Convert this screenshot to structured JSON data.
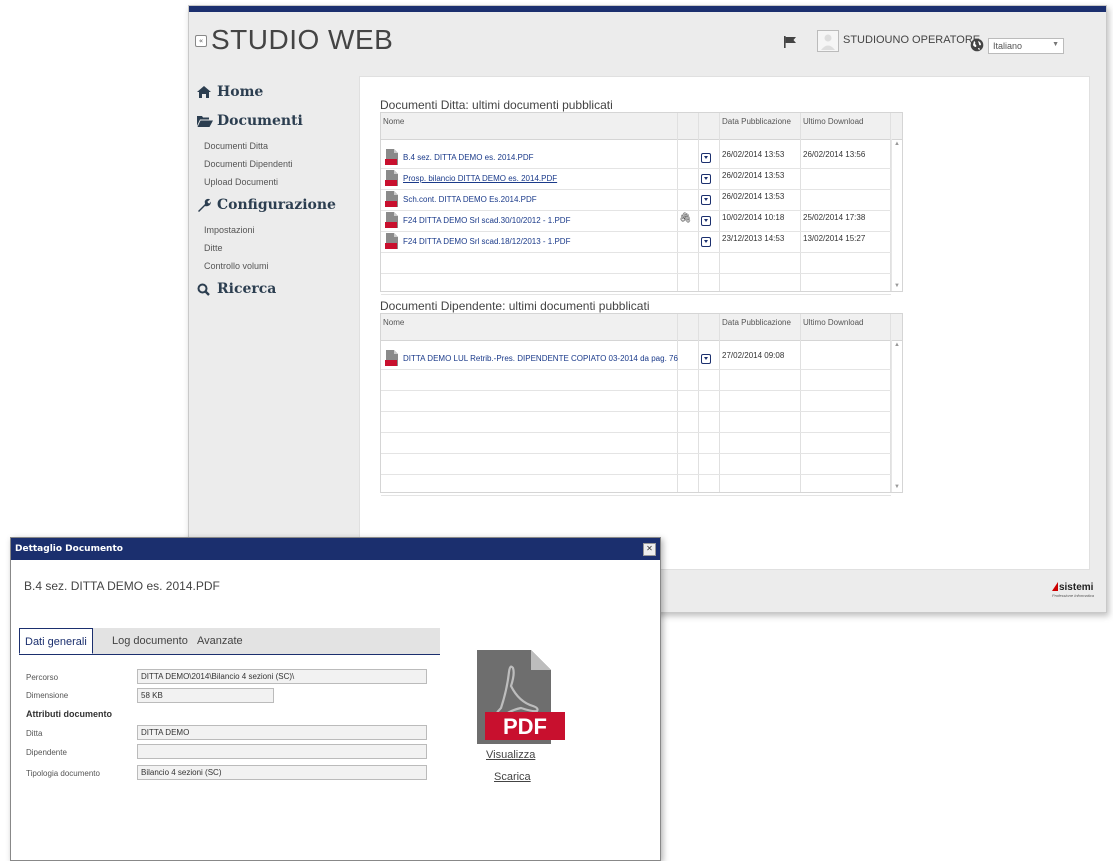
{
  "app": {
    "title": "STUDIO WEB",
    "collapse_label": "«",
    "user_name": "STUDIOUNO OPERATORE",
    "language": "Italiano"
  },
  "sidebar": {
    "home": "Home",
    "documenti": "Documenti",
    "documenti_items": [
      "Documenti Ditta",
      "Documenti Dipendenti",
      "Upload Documenti"
    ],
    "configurazione": "Configurazione",
    "configurazione_items": [
      "Impostazioni",
      "Ditte",
      "Controllo volumi"
    ],
    "ricerca": "Ricerca"
  },
  "ditta": {
    "title": "Documenti Ditta: ultimi documenti pubblicati",
    "columns": [
      "Nome",
      "Data Pubblicazione",
      "Ultimo Download"
    ],
    "rows": [
      {
        "name": "B.4 sez. DITTA DEMO es. 2014.PDF",
        "published": "26/02/2014 13:53",
        "downloaded": "26/02/2014 13:56",
        "underline": false,
        "clip": false
      },
      {
        "name": "Prosp. bilancio DITTA DEMO es. 2014.PDF",
        "published": "26/02/2014 13:53",
        "downloaded": "",
        "underline": true,
        "clip": false
      },
      {
        "name": "Sch.cont. DITTA DEMO Es.2014.PDF",
        "published": "26/02/2014 13:53",
        "downloaded": "",
        "underline": false,
        "clip": false
      },
      {
        "name": "F24 DITTA DEMO Srl scad.30/10/2012 - 1.PDF",
        "published": "10/02/2014 10:18",
        "downloaded": "25/02/2014 17:38",
        "underline": false,
        "clip": true
      },
      {
        "name": "F24 DITTA DEMO Srl scad.18/12/2013 - 1.PDF",
        "published": "23/12/2013 14:53",
        "downloaded": "13/02/2014 15:27",
        "underline": false,
        "clip": false
      }
    ]
  },
  "dipendente": {
    "title": "Documenti Dipendente: ultimi documenti pubblicati",
    "columns": [
      "Nome",
      "Data Pubblicazione",
      "Ultimo Download"
    ],
    "rows": [
      {
        "name": "DITTA DEMO LUL Retrib.-Pres. DIPENDENTE COPIATO 03-2014 da pag. 76",
        "published": "27/02/2014 09:08",
        "downloaded": "",
        "underline": false,
        "clip": false
      }
    ]
  },
  "footer": {
    "brand": "sistemi",
    "tagline": "Professione Informatica"
  },
  "dialog": {
    "title": "Dettaglio Documento",
    "close_label": "✕",
    "doc_name": "B.4 sez. DITTA DEMO es. 2014.PDF",
    "tabs": [
      "Dati generali",
      "Log documento",
      "Avanzate"
    ],
    "fields": {
      "percorso_label": "Percorso",
      "percorso": "DITTA DEMO\\2014\\Bilancio 4 sezioni (SC)\\",
      "dimensione_label": "Dimensione",
      "dimensione": "58 KB",
      "attributi_label": "Attributi documento",
      "ditta_label": "Ditta",
      "ditta": "DITTA DEMO",
      "dipendente_label": "Dipendente",
      "dipendente": "",
      "tipologia_label": "Tipologia documento",
      "tipologia": "Bilancio 4 sezioni (SC)"
    },
    "pdf_badge": "PDF",
    "visualizza": "Visualizza",
    "scarica": "Scarica"
  }
}
